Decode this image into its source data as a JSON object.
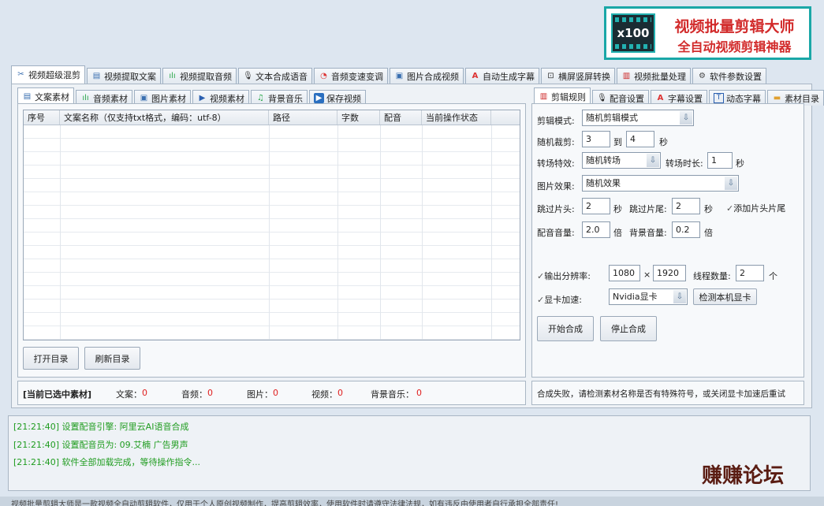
{
  "logo": {
    "badge": "x100",
    "title": "视频批量剪辑大师",
    "subtitle": "全自动视频剪辑神器"
  },
  "main_tabs": [
    {
      "label": "视频超级混剪",
      "icon": "scissors-icon",
      "active": true
    },
    {
      "label": "视频提取文案",
      "icon": "document-icon"
    },
    {
      "label": "视频提取音频",
      "icon": "audio-wave-icon"
    },
    {
      "label": "文本合成语音",
      "icon": "microphone-icon"
    },
    {
      "label": "音频变速变调",
      "icon": "speedometer-icon"
    },
    {
      "label": "图片合成视频",
      "icon": "image-icon"
    },
    {
      "label": "自动生成字幕",
      "icon": "subtitle-icon"
    },
    {
      "label": "横屏竖屏转换",
      "icon": "rotate-icon"
    },
    {
      "label": "视频批量处理",
      "icon": "film-icon"
    },
    {
      "label": "软件参数设置",
      "icon": "gear-icon"
    }
  ],
  "left_tabs": [
    {
      "label": "文案素材",
      "icon": "document-icon",
      "active": true
    },
    {
      "label": "音频素材",
      "icon": "audio-wave-icon"
    },
    {
      "label": "图片素材",
      "icon": "image-icon"
    },
    {
      "label": "视频素材",
      "icon": "play-icon"
    },
    {
      "label": "背景音乐",
      "icon": "music-note-icon"
    },
    {
      "label": "保存视频",
      "icon": "save-play-icon"
    }
  ],
  "table": {
    "columns": [
      "序号",
      "文案名称（仅支持txt格式，编码：utf-8）",
      "路径",
      "字数",
      "配音",
      "当前操作状态"
    ]
  },
  "buttons": {
    "open_dir": "打开目录",
    "refresh_dir": "刷新目录",
    "start": "开始合成",
    "stop": "停止合成",
    "detect_gpu": "检测本机显卡"
  },
  "status": {
    "title": "[当前已选中素材]",
    "items": [
      {
        "label": "文案：",
        "value": "0"
      },
      {
        "label": "音频：",
        "value": "0"
      },
      {
        "label": "图片：",
        "value": "0"
      },
      {
        "label": "视频：",
        "value": "0"
      },
      {
        "label": "背景音乐：",
        "value": "0"
      }
    ],
    "message": "合成失败，请检测素材名称是否有特殊符号，或关闭显卡加速后重试"
  },
  "right_tabs": [
    {
      "label": "剪辑规则",
      "icon": "film-icon",
      "active": true
    },
    {
      "label": "配音设置",
      "icon": "microphone-icon"
    },
    {
      "label": "字幕设置",
      "icon": "subtitle-icon"
    },
    {
      "label": "动态字幕",
      "icon": "text-box-icon"
    },
    {
      "label": "素材目录",
      "icon": "folder-icon"
    }
  ],
  "settings": {
    "mode_label": "剪辑模式:",
    "mode_value": "随机剪辑模式",
    "cut_label": "随机裁剪:",
    "cut_from": "3",
    "cut_to_label": "到",
    "cut_to": "4",
    "sec": "秒",
    "transition_label": "转场特效:",
    "transition_value": "随机转场",
    "transition_dur_label": "转场时长:",
    "transition_dur": "1",
    "image_effect_label": "图片效果:",
    "image_effect_value": "随机效果",
    "skip_head_label": "跳过片头:",
    "skip_head": "2",
    "skip_tail_label": "跳过片尾:",
    "skip_tail": "2",
    "add_head_tail": "添加片头片尾",
    "voice_vol_label": "配音音量:",
    "voice_vol": "2.0",
    "times": "倍",
    "bg_vol_label": "背景音量:",
    "bg_vol": "0.2",
    "output_res_label": "输出分辨率:",
    "res_w": "1080",
    "res_x": "×",
    "res_h": "1920",
    "threads_label": "线程数量:",
    "threads": "2",
    "unit": "个",
    "gpu_label": "显卡加速:",
    "gpu_value": "Nvidia显卡"
  },
  "log": [
    "[21:21:40] 设置配音引擎:  阿里云AI语音合成",
    "[21:21:40] 设置配音员为:  09.艾楠 广告男声",
    "[21:21:40] 软件全部加载完成，等待操作指令..."
  ],
  "watermark": "赚赚论坛",
  "footer": "视频批量剪辑大师是一款视频全自动剪辑软件，仅用于个人原创视频制作，提高剪辑效率，使用软件时请遵守法律法规，如有违反由使用者自行承担全部责任!"
}
